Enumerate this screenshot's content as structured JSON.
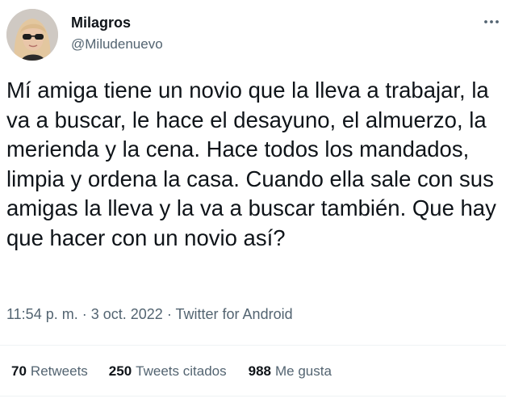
{
  "user": {
    "display_name": "Milagros",
    "handle": "@Miludenuevo"
  },
  "tweet": {
    "text": "Mí amiga tiene un novio que la lleva a trabajar, la va a buscar, le hace el desayuno, el almuerzo, la merienda y la cena. Hace todos los mandados, limpia y ordena la casa. Cuando ella sale con sus amigas la lleva y la va a buscar también. Que hay que hacer con un novio así?",
    "time": "11:54 p. m.",
    "separator": "·",
    "date": "3 oct. 2022",
    "source": "Twitter for Android"
  },
  "stats": {
    "retweets": {
      "count": "70",
      "label": "Retweets"
    },
    "quotes": {
      "count": "250",
      "label": "Tweets citados"
    },
    "likes": {
      "count": "988",
      "label": "Me gusta"
    }
  },
  "icons": {
    "more": "more-horizontal-icon"
  },
  "colors": {
    "text_primary": "#0f1419",
    "text_secondary": "#536471",
    "divider": "#eff3f4"
  }
}
